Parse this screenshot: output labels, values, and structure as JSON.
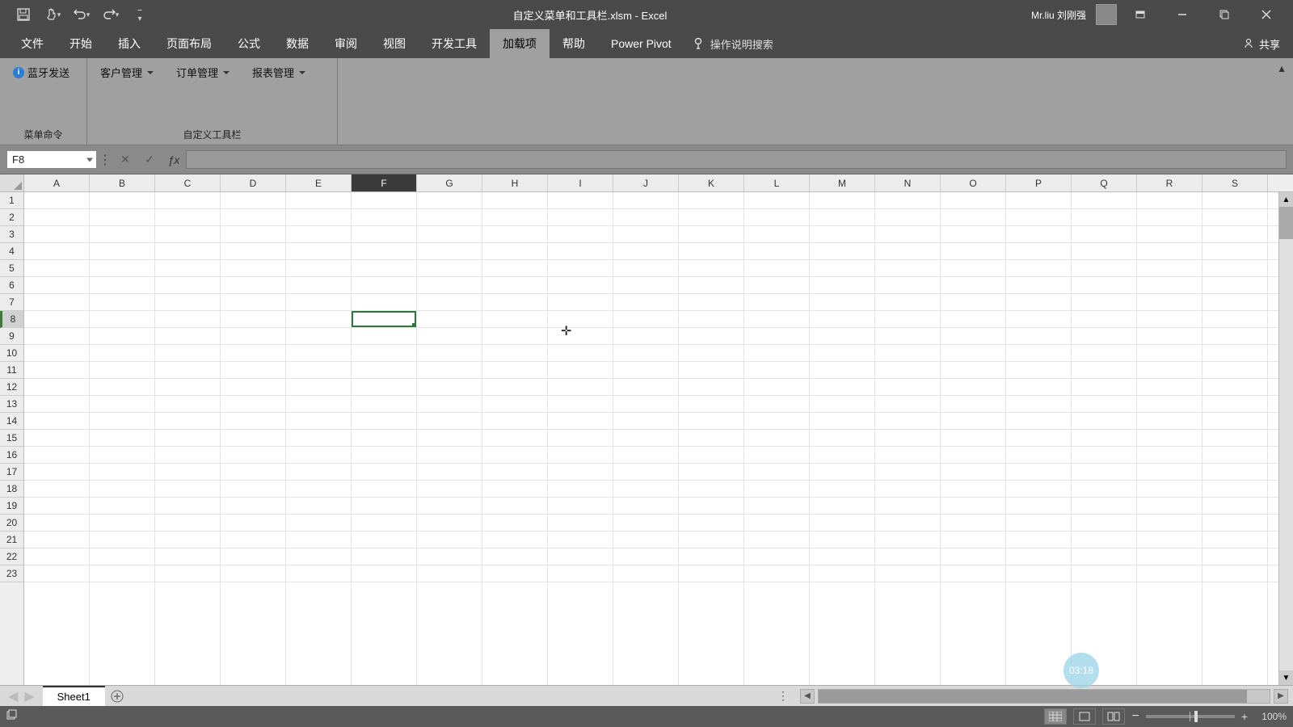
{
  "title": "自定义菜单和工具栏.xlsm  -  Excel",
  "user": "Mr.liu 刘刚强",
  "qat": {
    "save": "save-icon",
    "touch": "touch-icon",
    "undo": "undo-icon",
    "redo": "redo-icon"
  },
  "ribbon": {
    "tabs": [
      {
        "label": "文件"
      },
      {
        "label": "开始"
      },
      {
        "label": "插入"
      },
      {
        "label": "页面布局"
      },
      {
        "label": "公式"
      },
      {
        "label": "数据"
      },
      {
        "label": "审阅"
      },
      {
        "label": "视图"
      },
      {
        "label": "开发工具"
      },
      {
        "label": "加载项",
        "active": true
      },
      {
        "label": "帮助"
      },
      {
        "label": "Power Pivot"
      }
    ],
    "tell_me": "操作说明搜索",
    "share": "共享"
  },
  "addins": {
    "groups": [
      {
        "label": "菜单命令",
        "items": [
          {
            "label": "蓝牙发送",
            "icon": "bluetooth"
          }
        ]
      },
      {
        "label": "自定义工具栏",
        "items": [
          {
            "label": "客户管理",
            "dropdown": true
          },
          {
            "label": "订单管理",
            "dropdown": true
          },
          {
            "label": "报表管理",
            "dropdown": true
          }
        ]
      }
    ]
  },
  "formula_bar": {
    "name_box": "F8",
    "formula": ""
  },
  "grid": {
    "columns": [
      "A",
      "B",
      "C",
      "D",
      "E",
      "F",
      "G",
      "H",
      "I",
      "J",
      "K",
      "L",
      "M",
      "N",
      "O",
      "P",
      "Q",
      "R",
      "S"
    ],
    "active_col": "F",
    "rows_visible": 23,
    "active_row": 8,
    "active_cell": {
      "col_index": 5,
      "row_index": 7
    }
  },
  "sheet": {
    "tabs": [
      {
        "label": "Sheet1"
      }
    ]
  },
  "status": {
    "zoom": "100%",
    "rec_badge": "03:18"
  }
}
